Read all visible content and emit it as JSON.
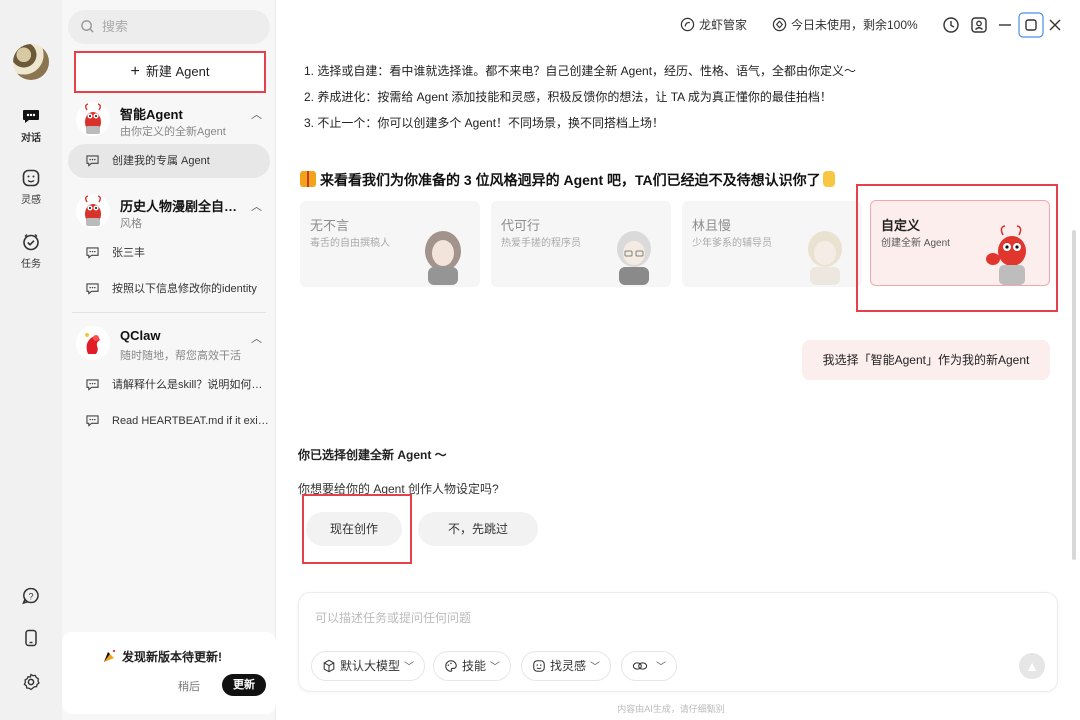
{
  "rail": {
    "items": [
      {
        "label": "对话",
        "icon": "chat-bubble-icon"
      },
      {
        "label": "灵感",
        "icon": "smile-face-icon"
      },
      {
        "label": "任务",
        "icon": "check-circle-icon"
      }
    ],
    "bottom_icons": [
      "help-icon",
      "mobile-icon",
      "settings-icon"
    ]
  },
  "sidebar": {
    "search_placeholder": "搜索",
    "new_agent_label": "新建 Agent",
    "groups": [
      {
        "name": "智能Agent",
        "subtitle": "由你定义的全新Agent",
        "conversations": [
          "创建我的专属 Agent"
        ]
      },
      {
        "name": "历史人物漫剧全自动生成助手",
        "subtitle": "风格",
        "conversations": [
          "张三丰",
          "按照以下信息修改你的identity"
        ]
      },
      {
        "name": "QClaw",
        "subtitle": "随时随地，帮您高效干活",
        "conversations": [
          "请解释什么是skill？说明如何使用",
          "Read HEARTBEAT.md if it exists"
        ]
      }
    ],
    "update": {
      "title": "发现新版本待更新!",
      "later": "稍后",
      "update": "更新"
    }
  },
  "topbar": {
    "manager": "龙虾管家",
    "usage": "今日未使用，剩余100%"
  },
  "main": {
    "intro": [
      "1. 选择或自建：看中谁就选择谁。都不来电？自己创建全新 Agent，经历、性格、语气，全都由你定义～",
      "2. 养成进化：按需给 Agent 添加技能和灵感，积极反馈你的想法，让 TA 成为真正懂你的最佳拍档！",
      "3. 不止一个：你可以创建多个 Agent！不同场景，换不同搭档上场！"
    ],
    "heading": "来看看我们为你准备的 3 位风格迥异的 Agent 吧，TA们已经迫不及待想认识你了",
    "cards": [
      {
        "name": "无不言",
        "desc": "毒舌的自由撰稿人"
      },
      {
        "name": "代可行",
        "desc": "热爱手搓的程序员"
      },
      {
        "name": "林且慢",
        "desc": "少年爹系的辅导员"
      },
      {
        "name": "自定义",
        "desc": "创建全新 Agent"
      }
    ],
    "user_message": "我选择「智能Agent」作为我的新Agent",
    "bot_title": "你已选择创建全新 Agent 〜",
    "bot_question": "你想要给你的 Agent 创作人物设定吗?",
    "choices": [
      "现在创作",
      "不，先跳过"
    ],
    "composer": {
      "placeholder": "可以描述任务或提问任何问题",
      "model": "默认大模型",
      "skills": "技能",
      "inspiration": "找灵感"
    },
    "disclaimer": "内容由AI生成，请仔细甄别"
  },
  "colors": {
    "accent_red": "#e5414b",
    "selected_card_bg": "#fdeeee"
  }
}
